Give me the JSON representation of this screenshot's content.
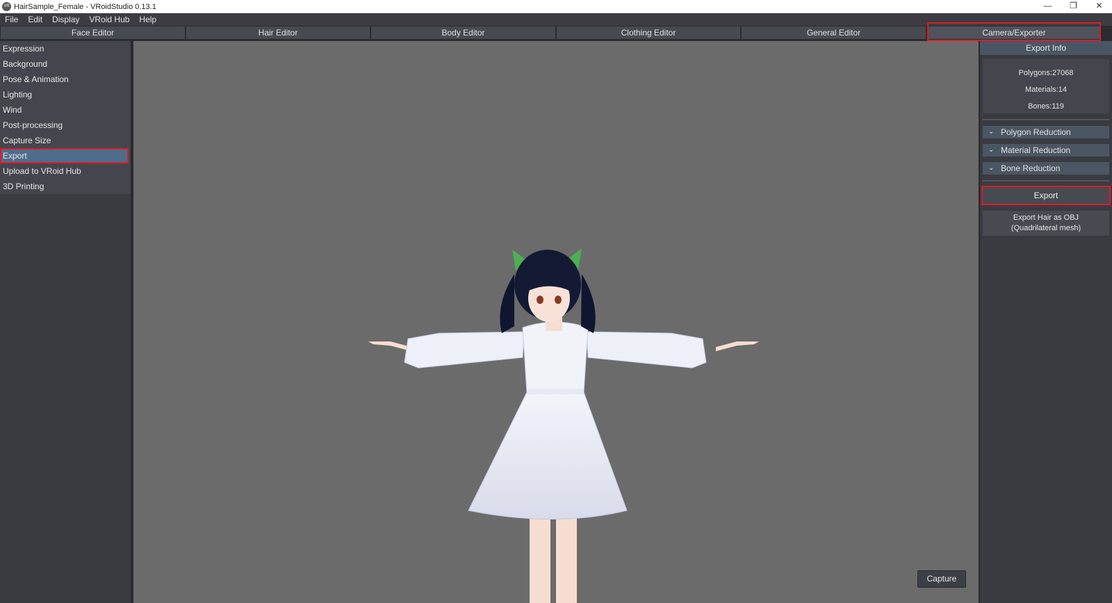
{
  "window": {
    "title": "HairSample_Female - VRoidStudio 0.13.1",
    "icon_label": "VR",
    "controls": [
      "—",
      "❐",
      "✕"
    ]
  },
  "menu": [
    "File",
    "Edit",
    "Display",
    "VRoid Hub",
    "Help"
  ],
  "tabs": [
    "Face Editor",
    "Hair Editor",
    "Body Editor",
    "Clothing Editor",
    "General Editor",
    "Camera/Exporter"
  ],
  "active_tab": "Camera/Exporter",
  "left_menu": [
    "Expression",
    "Background",
    "Pose & Animation",
    "Lighting",
    "Wind",
    "Post-processing",
    "Capture Size",
    "Export",
    "Upload to VRoid Hub",
    "3D Printing"
  ],
  "selected_left": "Export",
  "viewport": {
    "capture_label": "Capture",
    "background_color": "#6b6b6b"
  },
  "right_panel": {
    "header": "Export Info",
    "info": [
      "Polygons:27068",
      "Materials:14",
      "Bones:119"
    ],
    "sections": [
      "Polygon Reduction",
      "Material Reduction",
      "Bone Reduction"
    ],
    "export_label": "Export",
    "export_obj_line1": "Export Hair as OBJ",
    "export_obj_line2": "(Quadrilateral mesh)"
  },
  "colors": {
    "highlight": "#e01b24",
    "selection": "#4e6d8c",
    "section_bar": "#4b5664"
  }
}
